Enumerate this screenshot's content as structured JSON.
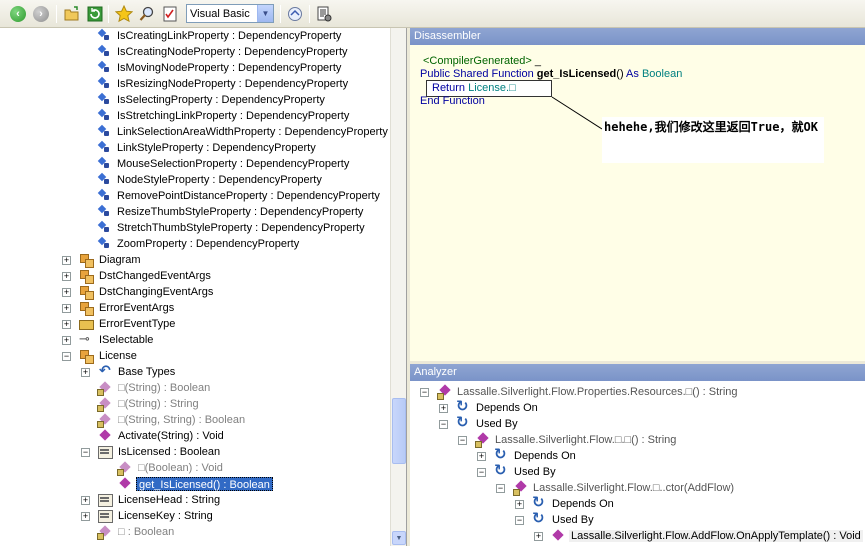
{
  "toolbar": {
    "language": "Visual Basic",
    "icons": [
      "back-icon",
      "forward-icon",
      "open-folder-icon",
      "refresh-icon",
      "favorites-star-icon",
      "search-icon",
      "checklist-icon",
      "language-dropdown",
      "open-package-icon",
      "disassemble-icon"
    ]
  },
  "tree": {
    "items": [
      {
        "label": "IsCreatingLinkProperty : DependencyProperty"
      },
      {
        "label": "IsCreatingNodeProperty : DependencyProperty"
      },
      {
        "label": "IsMovingNodeProperty : DependencyProperty"
      },
      {
        "label": "IsResizingNodeProperty : DependencyProperty"
      },
      {
        "label": "IsSelectingProperty : DependencyProperty"
      },
      {
        "label": "IsStretchingLinkProperty : DependencyProperty"
      },
      {
        "label": "LinkSelectionAreaWidthProperty : DependencyProperty"
      },
      {
        "label": "LinkStyleProperty : DependencyProperty"
      },
      {
        "label": "MouseSelectionProperty : DependencyProperty"
      },
      {
        "label": "NodeStyleProperty : DependencyProperty"
      },
      {
        "label": "RemovePointDistanceProperty : DependencyProperty"
      },
      {
        "label": "ResizeThumbStyleProperty : DependencyProperty"
      },
      {
        "label": "StretchThumbStyleProperty : DependencyProperty"
      },
      {
        "label": "ZoomProperty : DependencyProperty"
      },
      {
        "label": "Diagram"
      },
      {
        "label": "DstChangedEventArgs"
      },
      {
        "label": "DstChangingEventArgs"
      },
      {
        "label": "ErrorEventArgs"
      },
      {
        "label": "ErrorEventType"
      },
      {
        "label": "ISelectable"
      },
      {
        "label": "License"
      },
      {
        "label": "Base Types"
      },
      {
        "label": "□(String) : Boolean"
      },
      {
        "label": "□(String) : String"
      },
      {
        "label": "□(String, String) : Boolean"
      },
      {
        "label": "Activate(String) : Void"
      },
      {
        "label": "IsLicensed : Boolean"
      },
      {
        "label": "□(Boolean) : Void"
      },
      {
        "label": "get_IsLicensed() : Boolean"
      },
      {
        "label": "LicenseHead : String"
      },
      {
        "label": "LicenseKey : String"
      },
      {
        "label": "□ : Boolean"
      }
    ]
  },
  "disassembler": {
    "title": "Disassembler",
    "line1_attr": "<CompilerGenerated>",
    "line1_rest": " _",
    "line2_kw": "Public Shared Function",
    "line2_fn": "get_IsLicensed",
    "line2_args": "()",
    "line2_as": " As ",
    "line2_type": "Boolean",
    "return_kw": "Return",
    "return_val": "License.□",
    "end_line": "End Function",
    "callout": "hehehe,我们修改这里返回True，就OK"
  },
  "analyzer": {
    "title": "Analyzer",
    "items": [
      {
        "label": "Lassalle.Silverlight.Flow.Properties.Resources.□() : String"
      },
      {
        "label": "Depends On"
      },
      {
        "label": "Used By"
      },
      {
        "label": "Lassalle.Silverlight.Flow.□.□() : String"
      },
      {
        "label": "Depends On"
      },
      {
        "label": "Used By"
      },
      {
        "label": "Lassalle.Silverlight.Flow.□..ctor(AddFlow)"
      },
      {
        "label": "Depends On"
      },
      {
        "label": "Used By"
      },
      {
        "label": "Lassalle.Silverlight.Flow.AddFlow.OnApplyTemplate() : Void"
      }
    ]
  }
}
